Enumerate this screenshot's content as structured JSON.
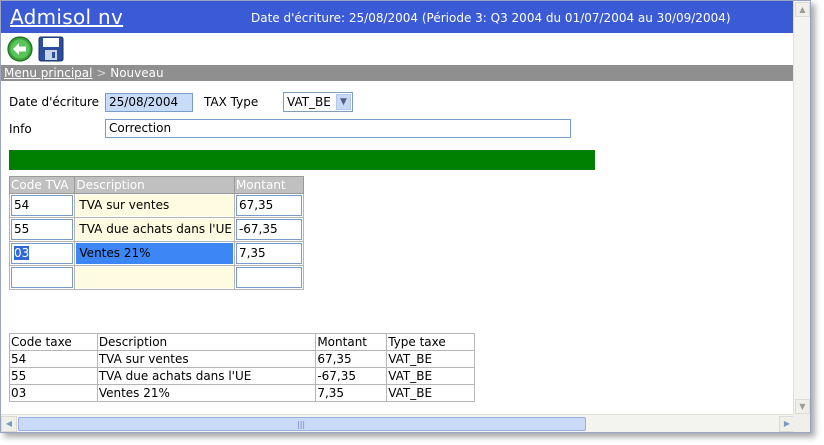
{
  "app": {
    "title": "Admisol nv"
  },
  "header": {
    "date_info": "Date d'écriture: 25/08/2004 (Période 3: Q3 2004 du 01/07/2004 au 30/09/2004)"
  },
  "toolbar": {
    "back_icon": "back-arrow-icon",
    "save_icon": "floppy-save-icon"
  },
  "breadcrumb": {
    "home": "Menu principal",
    "separator": ">",
    "current": "Nouveau"
  },
  "form": {
    "date_label": "Date d'écriture",
    "date_value": "25/08/2004",
    "tax_type_label": "TAX Type",
    "tax_type_value": "VAT_BE",
    "info_label": "Info",
    "info_value": "Correction"
  },
  "entry_grid": {
    "headers": [
      "Code TVA",
      "Description",
      "Montant"
    ],
    "rows": [
      {
        "code": "54",
        "description": "TVA sur ventes",
        "amount": "67,35"
      },
      {
        "code": "55",
        "description": "TVA due achats dans l'UE",
        "amount": "-67,35"
      },
      {
        "code": "03",
        "description": "Ventes 21%",
        "amount": "7,35"
      },
      {
        "code": "",
        "description": "",
        "amount": ""
      }
    ]
  },
  "summary": {
    "headers": [
      "Code taxe",
      "Description",
      "Montant",
      "Type taxe"
    ],
    "rows": [
      {
        "code": "54",
        "description": "TVA sur ventes",
        "amount": "67,35",
        "type": "VAT_BE"
      },
      {
        "code": "55",
        "description": "TVA due achats dans l'UE",
        "amount": "-67,35",
        "type": "VAT_BE"
      },
      {
        "code": "03",
        "description": "Ventes 21%",
        "amount": "7,35",
        "type": "VAT_BE"
      }
    ]
  },
  "colors": {
    "title_bar": "#3a5ad6",
    "green_bar": "#008000",
    "selection": "#3d86f5"
  }
}
